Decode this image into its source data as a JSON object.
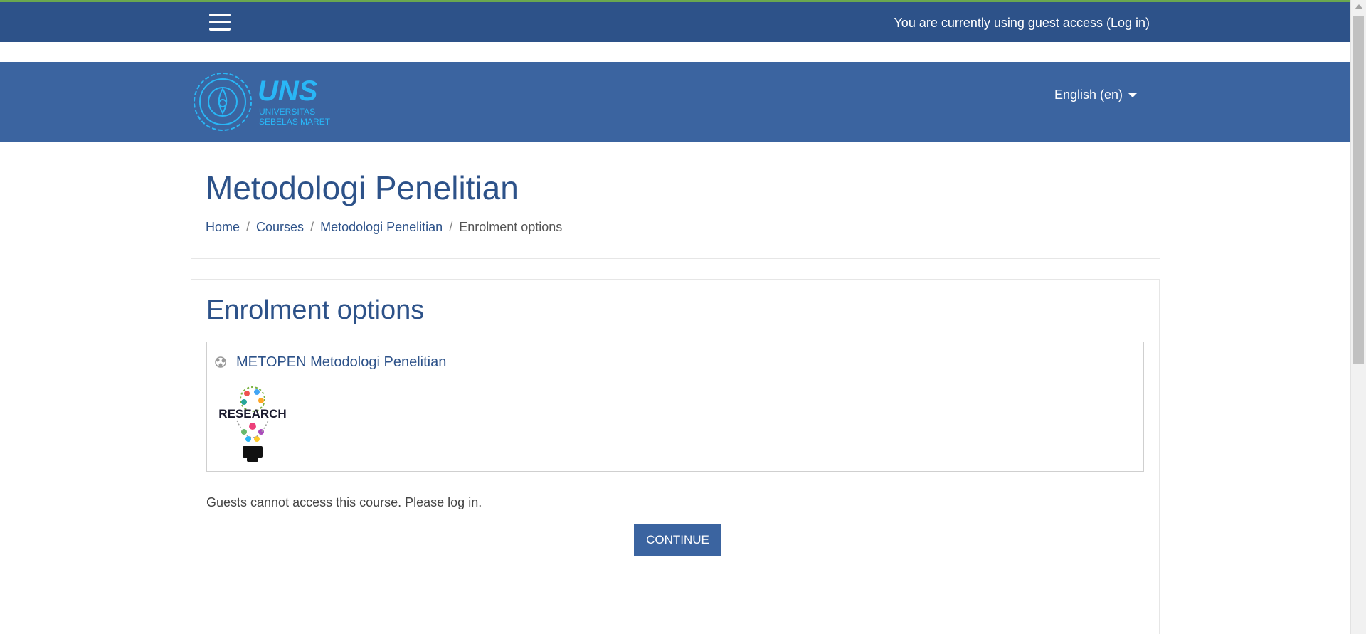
{
  "topbar": {
    "guest_prefix": "You are currently using guest access (",
    "login_link": "Log in",
    "guest_suffix": ")"
  },
  "header": {
    "logo": {
      "text": "UNS",
      "line1": "UNIVERSITAS",
      "line2": "SEBELAS MARET"
    },
    "language": "English (en)"
  },
  "page": {
    "title": "Metodologi Penelitian",
    "breadcrumb": [
      {
        "label": "Home"
      },
      {
        "label": "Courses"
      },
      {
        "label": "Metodologi Penelitian"
      },
      {
        "label": "Enrolment options"
      }
    ]
  },
  "main": {
    "section_title": "Enrolment options",
    "course": {
      "name": "METOPEN Metodologi Penelitian",
      "image_text": "RESEARCH"
    },
    "guest_message": "Guests cannot access this course. Please log in.",
    "continue_label": "CONTINUE"
  },
  "colors": {
    "topbar": "#2d5289",
    "header": "#3b64a0",
    "accent_line": "#6aa84f",
    "logo": "#29b6f6",
    "link": "#2d5289"
  }
}
